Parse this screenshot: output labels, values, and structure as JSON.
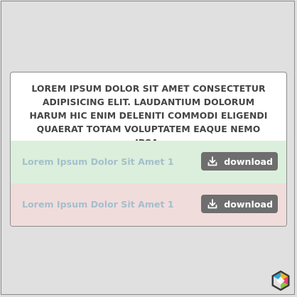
{
  "card": {
    "header_text": "Lorem ipsum dolor sit amet consectetur adipisicing elit. Laudantium dolorum harum hic enim deleniti commodi eligendi quaerat totam voluptatem eaque nemo ipsa,"
  },
  "rows": [
    {
      "label": "Lorem Ipsum Dolor Sit Amet 1",
      "button_label": "download",
      "icon": "download-icon",
      "background": "#dcefdc"
    },
    {
      "label": "Lorem Ipsum Dolor Sit Amet 1",
      "button_label": "download",
      "icon": "download-icon",
      "background": "#f1dcdc"
    }
  ],
  "colors": {
    "page_background": "#e0e0e0",
    "button_background": "#6e6e6e",
    "label_text": "#a3bfcc",
    "header_text": "#444444"
  },
  "logo": {
    "icon": "hexagon-logo-icon"
  }
}
